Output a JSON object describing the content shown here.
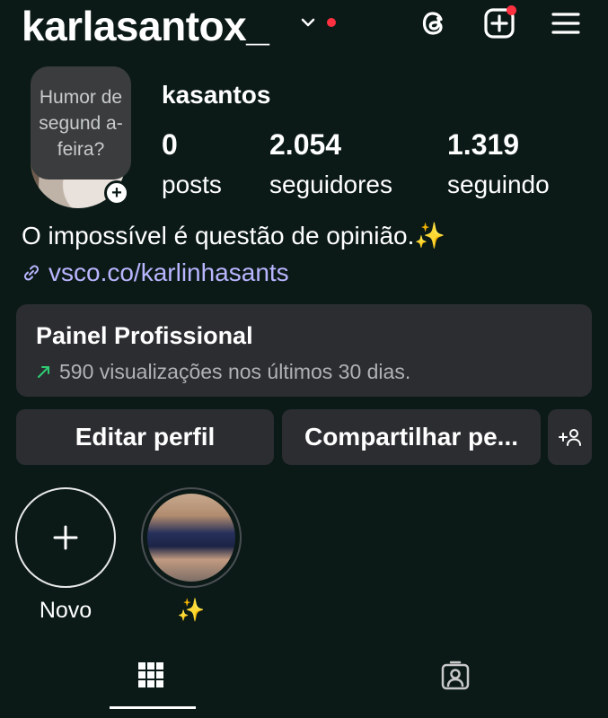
{
  "header": {
    "username": "karlasantox_",
    "notification_color": "#ff3040"
  },
  "profile": {
    "note_text": "Humor de segund a-feira?",
    "avatar_add_label": "+",
    "display_name": "kasantos",
    "stats": [
      {
        "value": "0",
        "label": "posts"
      },
      {
        "value": "2.054",
        "label": "seguidores"
      },
      {
        "value": "1.319",
        "label": "seguindo"
      }
    ],
    "bio": "O impossível é questão de opinião.✨",
    "link": "vsco.co/karlinhasants",
    "link_color": "#b9b5ff"
  },
  "dashboard": {
    "title": "Painel Profissional",
    "subtitle": "590 visualizações nos últimos 30 dias.",
    "trend_color": "#2ecc71"
  },
  "buttons": {
    "edit": "Editar perfil",
    "share": "Compartilhar pe..."
  },
  "highlights": [
    {
      "label": "Novo"
    },
    {
      "label": "✨"
    }
  ],
  "tabs": {
    "icons": [
      "grid-icon",
      "tagged-icon"
    ]
  }
}
